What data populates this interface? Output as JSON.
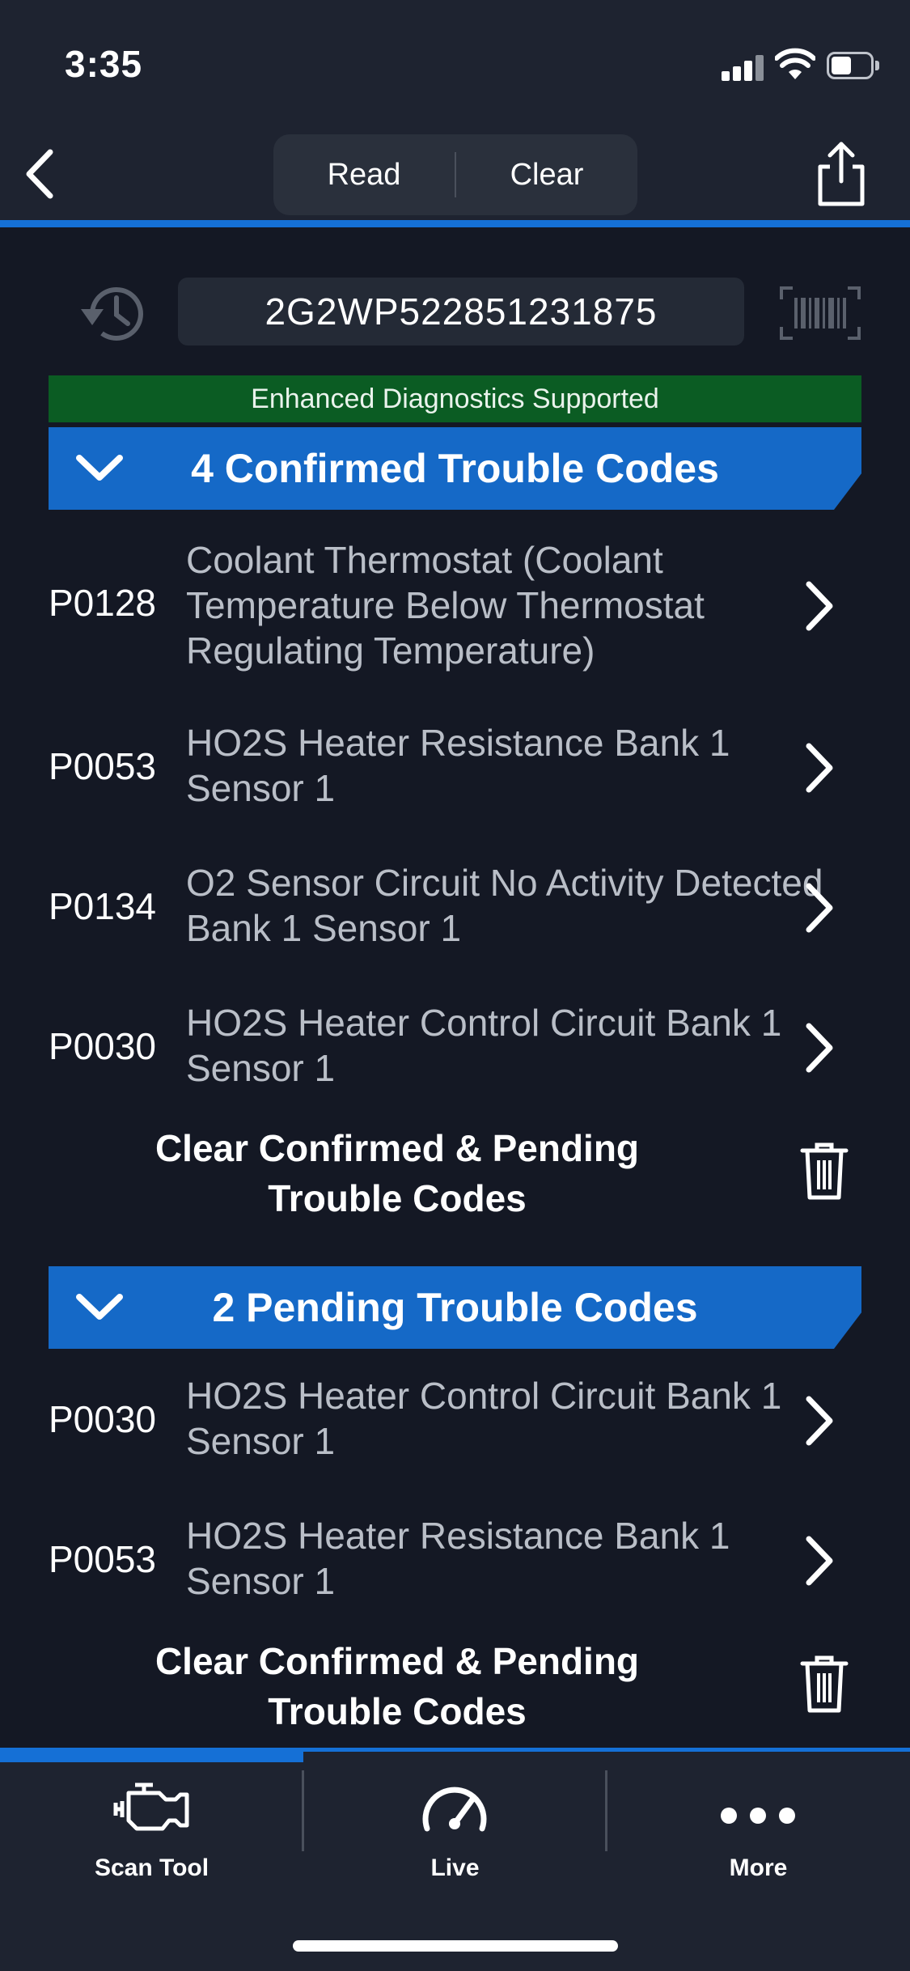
{
  "status_bar": {
    "time": "3:35"
  },
  "header": {
    "segments": [
      {
        "label": "Read"
      },
      {
        "label": "Clear"
      }
    ]
  },
  "vin": {
    "value": "2G2WP522851231875"
  },
  "banner": {
    "text": "Enhanced Diagnostics Supported"
  },
  "confirmed": {
    "title": "4 Confirmed Trouble Codes",
    "items": [
      {
        "code": "P0128",
        "desc": "Coolant Thermostat (Coolant Temperature Below Thermostat Regulating Temperature)"
      },
      {
        "code": "P0053",
        "desc": "HO2S Heater Resistance Bank 1 Sensor 1"
      },
      {
        "code": "P0134",
        "desc": "O2 Sensor Circuit No Activity Detected Bank 1 Sensor 1"
      },
      {
        "code": "P0030",
        "desc": "HO2S Heater Control Circuit Bank 1 Sensor 1"
      }
    ],
    "clear_label": "Clear Confirmed & Pending Trouble Codes"
  },
  "pending": {
    "title": "2 Pending Trouble Codes",
    "items": [
      {
        "code": "P0030",
        "desc": "HO2S Heater Control Circuit Bank 1 Sensor 1"
      },
      {
        "code": "P0053",
        "desc": "HO2S Heater Resistance Bank 1 Sensor 1"
      }
    ],
    "clear_label": "Clear Confirmed & Pending Trouble Codes"
  },
  "tabbar": {
    "tabs": [
      {
        "label": "Scan Tool",
        "icon": "engine-icon"
      },
      {
        "label": "Live",
        "icon": "gauge-icon"
      },
      {
        "label": "More",
        "icon": "more-dots-icon"
      }
    ]
  },
  "colors": {
    "accent": "#1570d6",
    "section_header": "#1569c7",
    "banner_green": "#0b5c23",
    "background": "#141824"
  }
}
